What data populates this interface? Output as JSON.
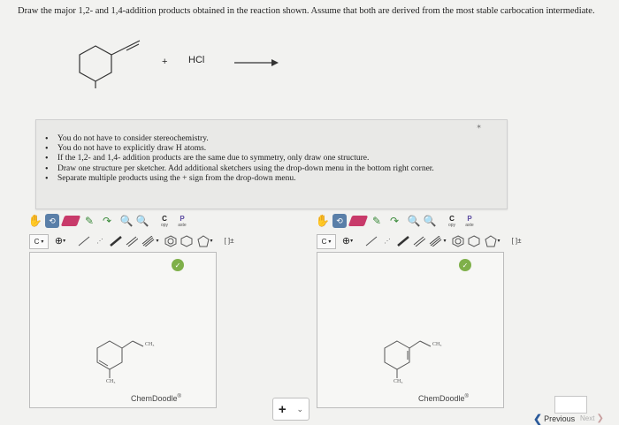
{
  "question": {
    "text": "Draw the major 1,2- and 1,4-addition products obtained in the reaction shown. Assume that both are derived from the most stable carbocation intermediate."
  },
  "reaction": {
    "plus": "+",
    "reagent": "HCl"
  },
  "instructions": {
    "items": [
      "You do not have to consider stereochemistry.",
      "You do not have to explicitly draw H atoms.",
      "If the 1,2- and 1,4- addition products are the same due to symmetry, only draw one structure.",
      "Draw one structure per sketcher. Add additional sketchers using the drop-down menu in the bottom right corner.",
      "Separate multiple products using the + sign from the drop-down menu."
    ]
  },
  "sketchers": [
    {
      "copy_label": "C",
      "copy_sub": "opy",
      "paste_label": "P",
      "paste_sub": "aste",
      "c_tool": "C",
      "bracket_tool": "[ ]±",
      "substituent": "CH₃",
      "ring_label": "CH₃",
      "brand": "ChemDoodle"
    },
    {
      "copy_label": "C",
      "copy_sub": "opy",
      "paste_label": "P",
      "paste_sub": "aste",
      "c_tool": "C",
      "bracket_tool": "[ ]±",
      "substituent": "CH₃",
      "ring_label": "CH₃",
      "brand": "ChemDoodle"
    }
  ],
  "footer": {
    "separator_value": "+",
    "previous_label": "Previous",
    "next_label": "Next"
  }
}
